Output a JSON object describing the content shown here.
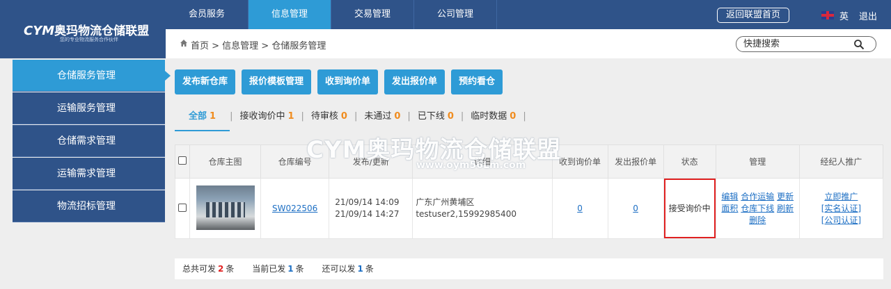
{
  "logo": {
    "brand": "CYM",
    "name": "奥玛物流仓储联盟",
    "tagline": "您的专业物流服务合作伙伴"
  },
  "nav": {
    "items": [
      "会员服务",
      "信息管理",
      "交易管理",
      "公司管理"
    ],
    "active": 1
  },
  "header": {
    "back_label": "返回联盟首页",
    "lang_label": "英",
    "logout_label": "退出"
  },
  "breadcrumb": {
    "text": "首页 > 信息管理 > 仓储服务管理"
  },
  "search": {
    "placeholder": "快捷搜索"
  },
  "sidebar": {
    "items": [
      "仓储服务管理",
      "运输服务管理",
      "仓储需求管理",
      "运输需求管理",
      "物流招标管理"
    ],
    "active": 0
  },
  "actions": [
    "发布新仓库",
    "报价模板管理",
    "收到询价单",
    "发出报价单",
    "预约看仓"
  ],
  "tabs": [
    {
      "label": "全部",
      "count": "1"
    },
    {
      "label": "接收询价中",
      "count": "1"
    },
    {
      "label": "待审核",
      "count": "0"
    },
    {
      "label": "未通过",
      "count": "0"
    },
    {
      "label": "已下线",
      "count": "0"
    },
    {
      "label": "临时数据",
      "count": "0"
    }
  ],
  "table": {
    "headers": [
      "仓库主图",
      "仓库编号",
      "发布/更新",
      "详细",
      "收到询价单",
      "发出报价单",
      "状态",
      "管理",
      "经纪人推广"
    ],
    "rows": [
      {
        "code": "SW022506",
        "published": "21/09/14 14:09",
        "updated": "21/09/14 14:27",
        "location": "广东广州黄埔区",
        "contact": "testuser2,15992985400",
        "inquiries": "0",
        "quotes": "0",
        "status": "接受询价中",
        "manage_links": [
          "编辑",
          "合作运输",
          "更新",
          "面积",
          "仓库下线",
          "刷新",
          "删除"
        ],
        "agent_links": [
          "立即推广",
          "[实名认证]",
          "[公司认证]"
        ]
      }
    ]
  },
  "footer": {
    "total_label": "总共可发",
    "total_value": "2",
    "unit": "条",
    "current_label": "当前已发",
    "current_value": "1",
    "remaining_label": "还可以发",
    "remaining_value": "1"
  },
  "watermark": {
    "text": "CYM奥玛物流仓储联盟",
    "url": "www.oym56Lm.com"
  },
  "colors": {
    "navy": "#2f5389",
    "accent": "#2e9bd6",
    "link": "#1d6fc4",
    "highlight": "#e02020",
    "count": "#f08c1e"
  }
}
